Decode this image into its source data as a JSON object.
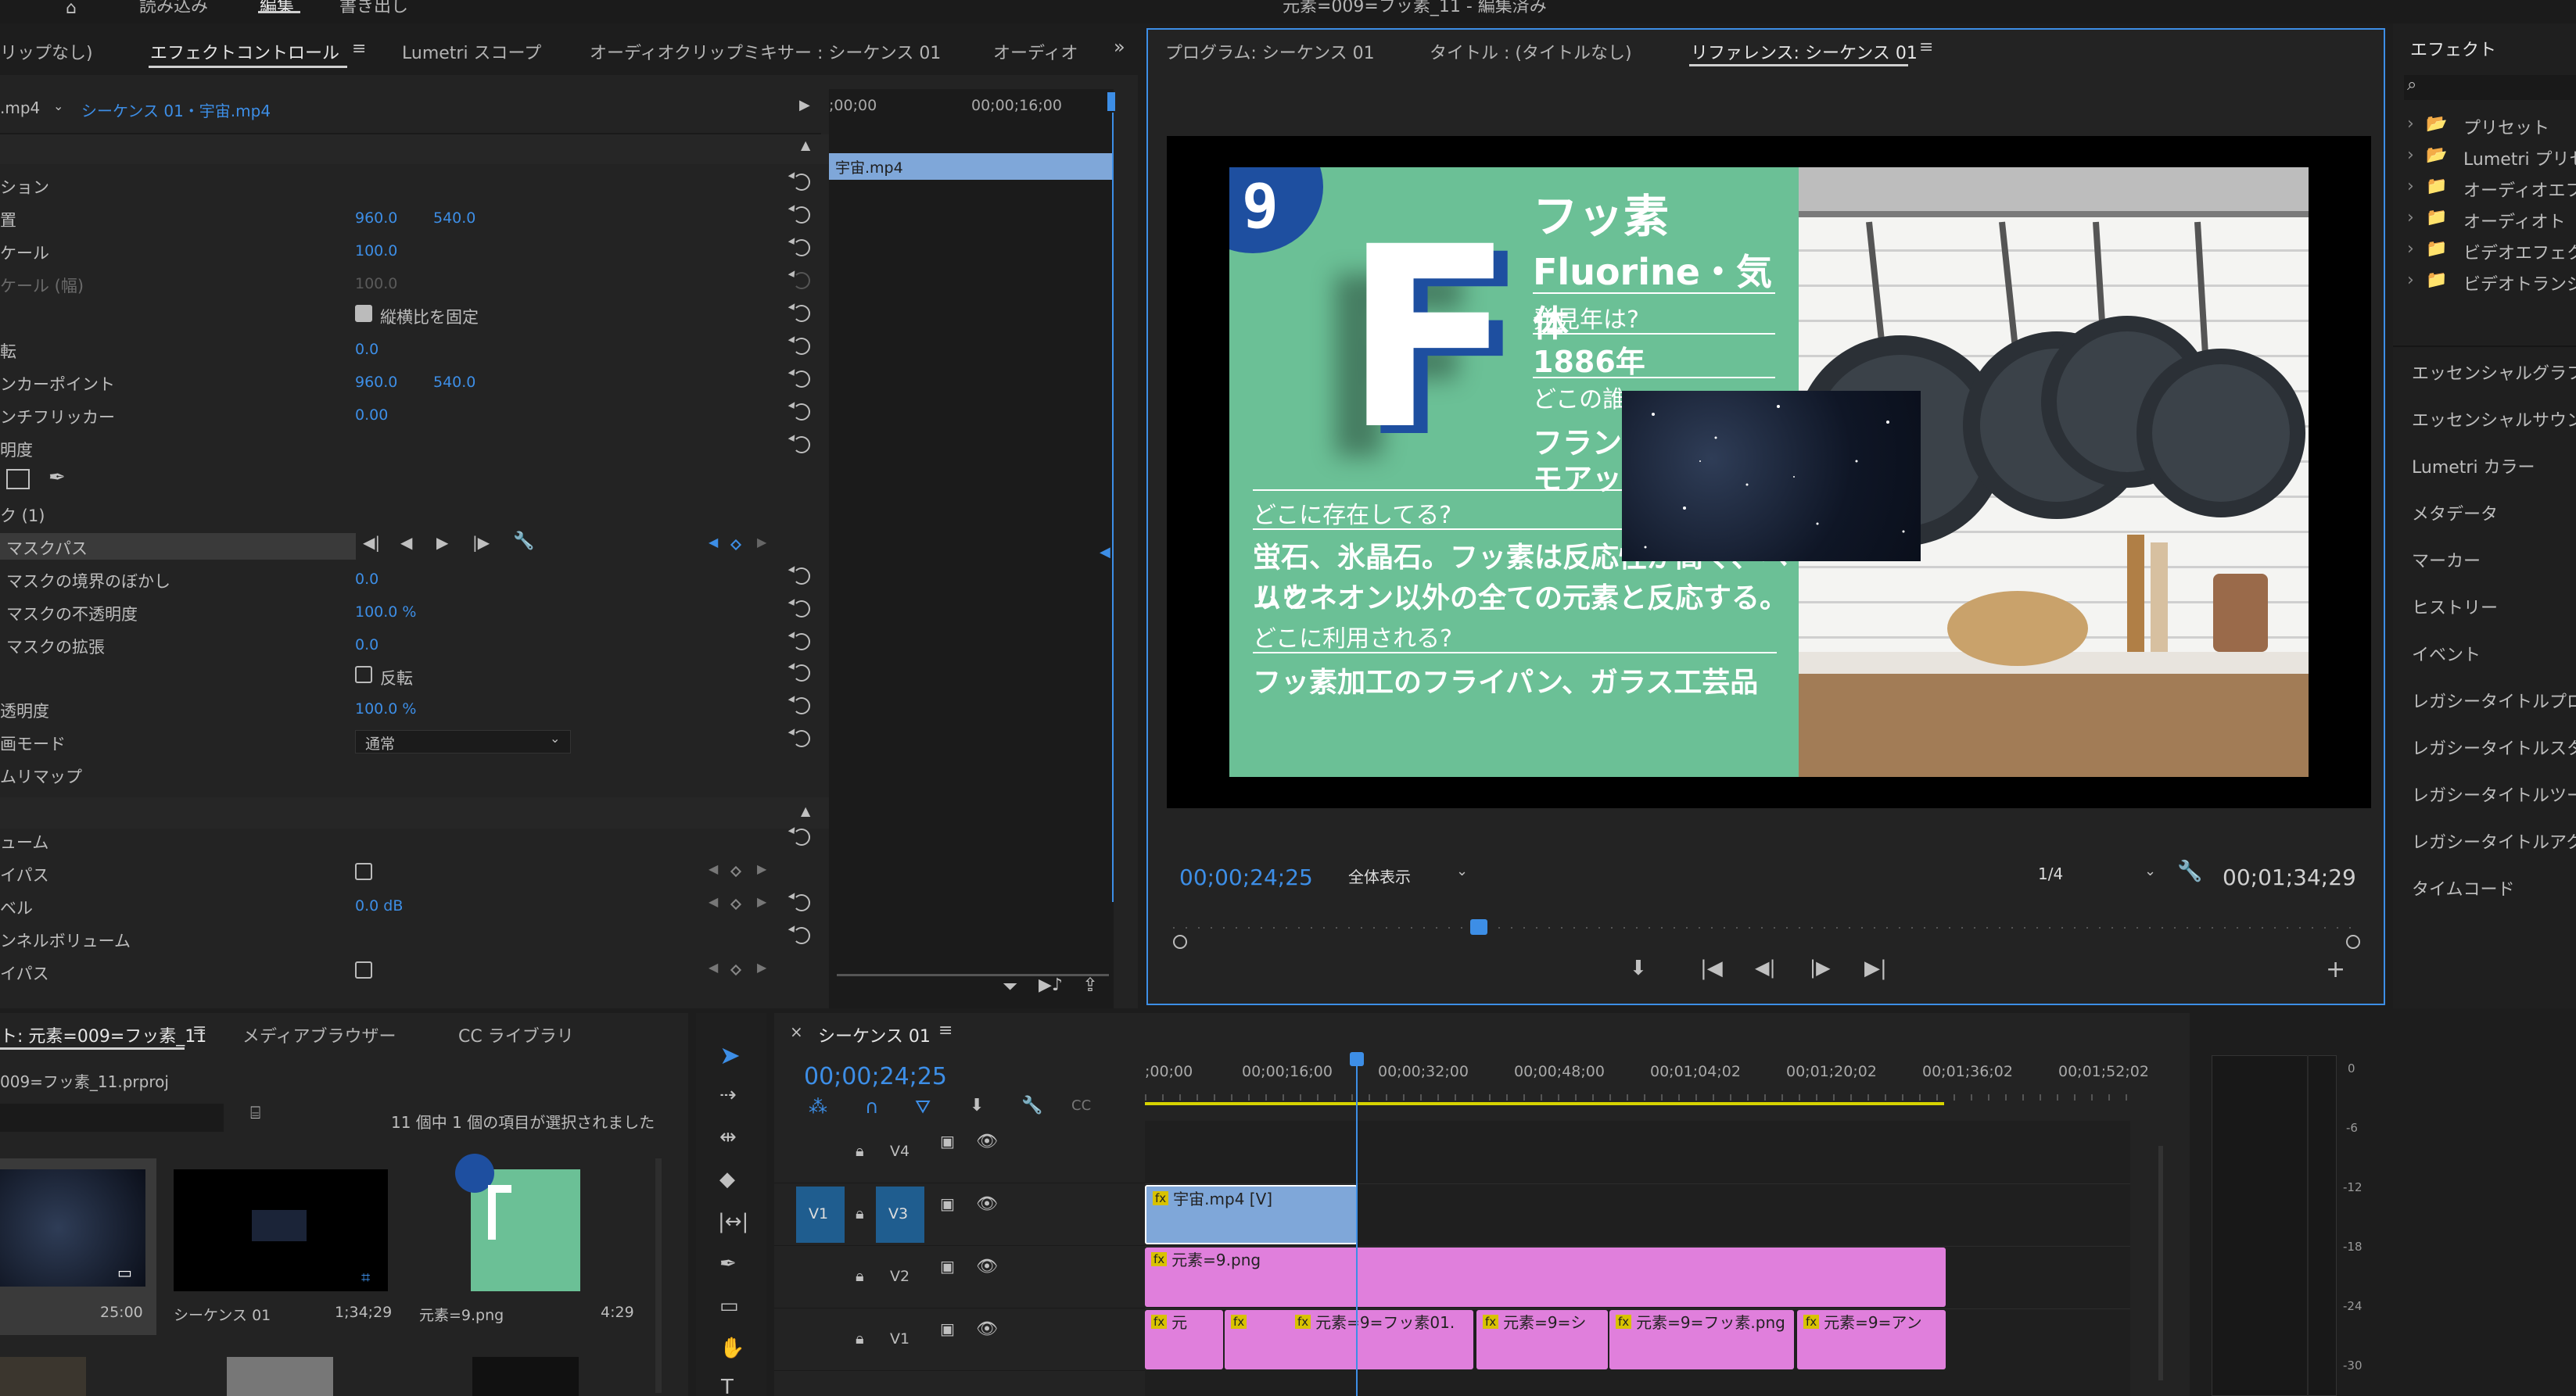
{
  "top_bar": {
    "items": [
      "読み込み",
      "編集",
      "書き出し"
    ],
    "title": "元素=009=フッ素_11 - 編集済み"
  },
  "effect_panel": {
    "tabs": [
      "リップなし)",
      "エフェクトコントロール",
      "Lumetri スコープ",
      "オーディオクリップミキサー : シーケンス 01",
      "オーディオ"
    ],
    "source_label": ".mp4",
    "sequence_label": "シーケンス 01・宇宙.mp4",
    "rows": [
      {
        "label": "ション",
        "v1": "",
        "v2": ""
      },
      {
        "label": "置",
        "v1": "960.0",
        "v2": "540.0"
      },
      {
        "label": "ケール",
        "v1": "100.0",
        "v2": ""
      },
      {
        "label": "ケール (幅)",
        "v1": "100.0",
        "v2": ""
      },
      {
        "label": "",
        "v1": "縦横比を固定",
        "v2": ""
      },
      {
        "label": "転",
        "v1": "0.0",
        "v2": ""
      },
      {
        "label": "ンカーポイント",
        "v1": "960.0",
        "v2": "540.0"
      },
      {
        "label": "ンチフリッカー",
        "v1": "0.00",
        "v2": ""
      },
      {
        "label": "明度",
        "v1": "",
        "v2": ""
      },
      {
        "label": "",
        "v1": "",
        "v2": ""
      },
      {
        "label": "ク (1)",
        "v1": "",
        "v2": ""
      },
      {
        "label": "マスクパス",
        "v1": "",
        "v2": ""
      },
      {
        "label": "マスクの境界のぼかし",
        "v1": "0.0",
        "v2": ""
      },
      {
        "label": "マスクの不透明度",
        "v1": "100.0 %",
        "v2": ""
      },
      {
        "label": "マスクの拡張",
        "v1": "0.0",
        "v2": ""
      },
      {
        "label": "",
        "v1": "反転",
        "v2": ""
      },
      {
        "label": "透明度",
        "v1": "100.0 %",
        "v2": ""
      },
      {
        "label": "画モード",
        "v1": "通常",
        "v2": ""
      },
      {
        "label": "ムリマップ",
        "v1": "",
        "v2": ""
      },
      {
        "label": "",
        "v1": "",
        "v2": ""
      },
      {
        "label": "ューム",
        "v1": "",
        "v2": ""
      },
      {
        "label": "イパス",
        "v1": "",
        "v2": ""
      },
      {
        "label": "ベル",
        "v1": "0.0 dB",
        "v2": ""
      },
      {
        "label": "ンネルボリューム",
        "v1": "",
        "v2": ""
      },
      {
        "label": "イパス",
        "v1": "",
        "v2": ""
      }
    ],
    "mini_tl": {
      "t0": ";00;00",
      "t1": "00;00;16;00",
      "clip": "宇宙.mp4"
    }
  },
  "program": {
    "tabs": [
      "プログラム: シーケンス 01",
      "タイトル : (タイトルなし)",
      "リファレンス: シーケンス 01"
    ],
    "timecode": "00;00;24;25",
    "fit": "全体表示",
    "quality": "1/4",
    "duration": "00;01;34;29",
    "slide": {
      "num": "9",
      "letter": "F",
      "name_jp": "フッ素",
      "name_en": "Fluorine・気体",
      "q1": "発見年は?",
      "a1": "1886年",
      "q2": "どこの誰",
      "a2a": "フラン",
      "a2b": "モアッ",
      "q3": "どこに存在してる?",
      "a3a": "蛍石、氷晶石。フッ素は反応性が高く、ヘリウ",
      "a3b": "ムとネオン以外の全ての元素と反応する。",
      "q4": "どこに利用される?",
      "a4": "フッ素加工のフライパン、ガラス工芸品"
    }
  },
  "effects_panel": {
    "title": "エフェクト",
    "tree": [
      "プリセット",
      "Lumetri プリセ",
      "オーディオエフ",
      "オーディオト",
      "ビデオエフェク",
      "ビデオトランジ"
    ],
    "items": [
      "エッセンシャルグラフ",
      "エッセンシャルサウン",
      "Lumetri カラー",
      "メタデータ",
      "マーカー",
      "ヒストリー",
      "イベント",
      "レガシータイトルプロ",
      "レガシータイトルスタ",
      "レガシータイトルツー",
      "レガシータイトルアク",
      "タイムコード"
    ]
  },
  "project": {
    "tabs": [
      "ト: 元素=009=フッ素_11",
      "メディアブラウザー",
      "CC ライブラリ"
    ],
    "file": "009=フッ素_11.prproj",
    "status": "11 個中 1 個の項目が選択されました",
    "items": [
      {
        "name": "",
        "dur": "25:00"
      },
      {
        "name": "シーケンス 01",
        "dur": "1;34;29"
      },
      {
        "name": "元素=9.png",
        "dur": "4:29"
      }
    ]
  },
  "timeline": {
    "title": "シーケンス 01",
    "timecode": "00;00;24;25",
    "ruler": [
      ";00;00",
      "00;00;16;00",
      "00;00;32;00",
      "00;00;48;00",
      "00;01;04;02",
      "00;01;20;02",
      "00;01;36;02",
      "00;01;52;02"
    ],
    "tracks": [
      "V4",
      "V3",
      "V2",
      "V1"
    ],
    "src_patch": "V1",
    "clips_v3": [
      "宇宙.mp4 [V]"
    ],
    "clips_v2": [
      "元素=9.png"
    ],
    "clips_v1": [
      "元",
      "元素=9=フッ素01.",
      "元素=9=シ",
      "元素=9=フッ素.png",
      "元素=9=アン"
    ]
  },
  "meter": {
    "labels": [
      "0",
      "-6",
      "-12",
      "-18",
      "-24",
      "-30"
    ]
  },
  "colors": {
    "accent": "#3d8ee6",
    "clip_blue": "#7fa7d9",
    "clip_pink": "#e07fdc",
    "slide_green": "#6bc096"
  }
}
